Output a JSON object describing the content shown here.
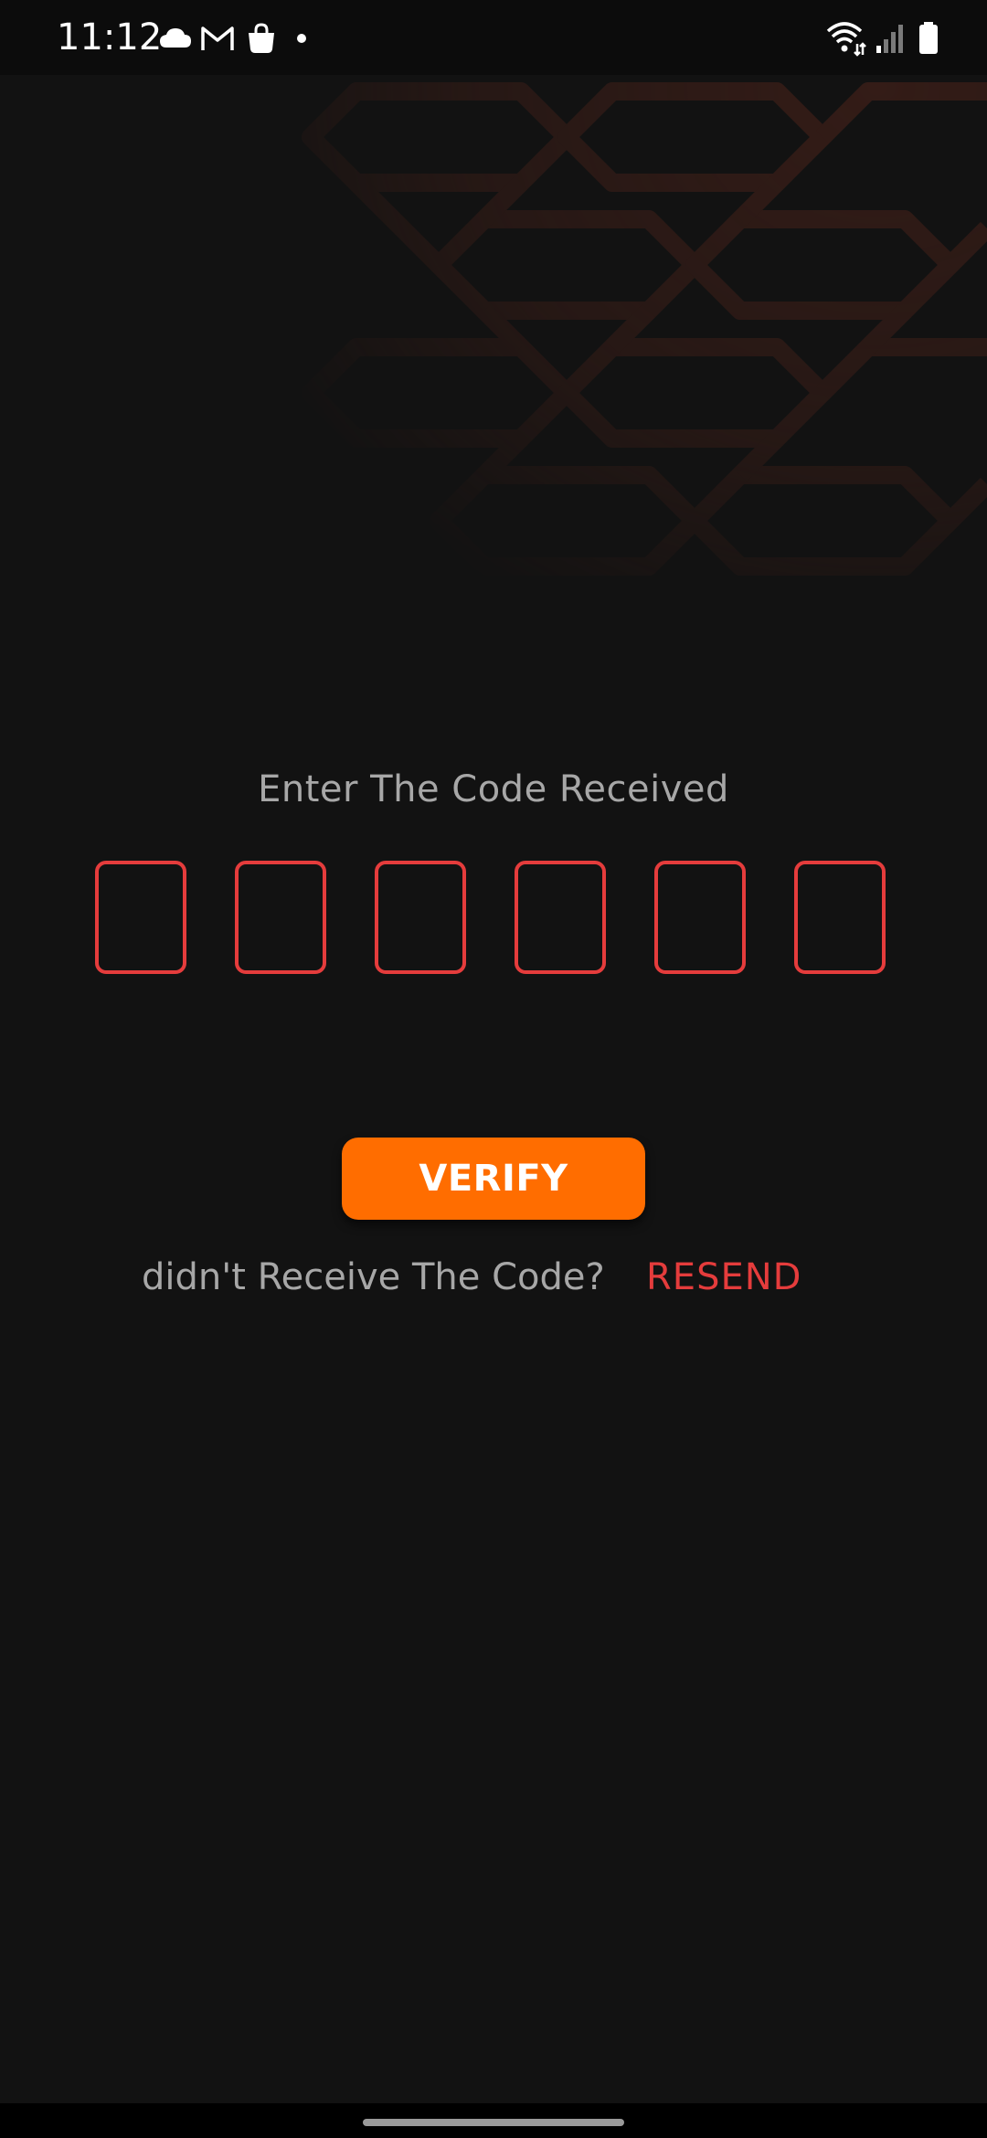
{
  "status_bar": {
    "time": "11:12",
    "left_icons": [
      "cloud-icon",
      "gmail-icon",
      "shopping-bag-icon",
      "dot-icon"
    ],
    "right_icons": [
      "wifi-icon",
      "signal-icon",
      "battery-icon"
    ]
  },
  "verification": {
    "title": "Enter The Code Received",
    "code_digits": [
      "",
      "",
      "",
      "",
      "",
      ""
    ],
    "verify_label": "VERIFY",
    "resend_question": "didn't Receive The Code?",
    "resend_label": "RESEND"
  },
  "colors": {
    "background": "#121212",
    "accent_orange": "#ff6d00",
    "accent_red": "#e53c3c",
    "text_muted": "#a7a7a7"
  }
}
